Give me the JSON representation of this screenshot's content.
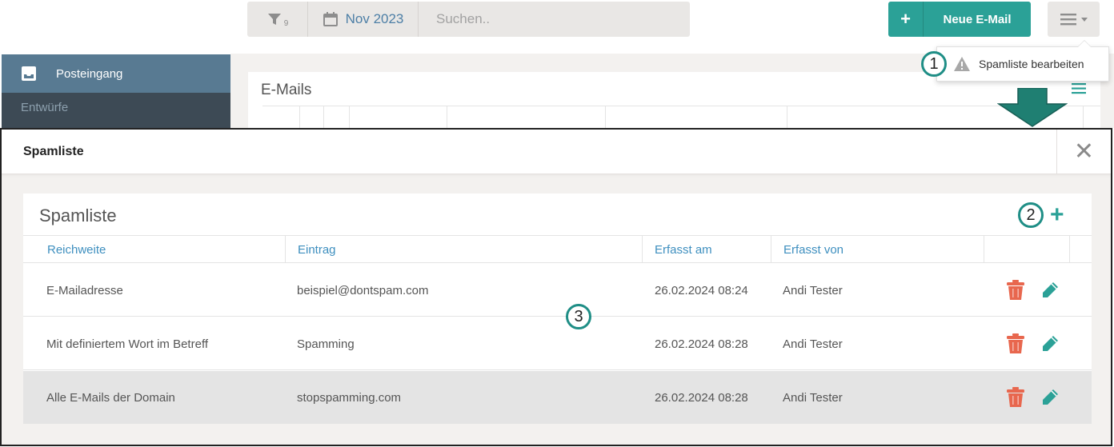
{
  "toolbar": {
    "filter_count": "9",
    "date_label": "Nov 2023",
    "search_placeholder": "Suchen.."
  },
  "new_mail": {
    "label": "Neue E-Mail"
  },
  "dropdown": {
    "spam_item_label": "Spamliste bearbeiten"
  },
  "callouts": {
    "one": "1",
    "two": "2",
    "three": "3"
  },
  "sidebar": {
    "items": [
      {
        "label": "Posteingang"
      },
      {
        "label": "Entwürfe"
      }
    ]
  },
  "emails_panel": {
    "title": "E-Mails"
  },
  "modal": {
    "title": "Spamliste",
    "panel_title": "Spamliste",
    "columns": [
      "Reichweite",
      "Eintrag",
      "Erfasst am",
      "Erfasst von"
    ],
    "rows": [
      {
        "scope": "E-Mailadresse",
        "entry": "beispiel@dontspam.com",
        "date": "26.02.2024 08:24",
        "by": "Andi Tester"
      },
      {
        "scope": "Mit definiertem Wort im Betreff",
        "entry": "Spamming",
        "date": "26.02.2024 08:28",
        "by": "Andi Tester"
      },
      {
        "scope": "Alle E-Mails der Domain",
        "entry": "stopspamming.com",
        "date": "26.02.2024 08:28",
        "by": "Andi Tester"
      }
    ]
  },
  "colors": {
    "accent_teal": "#2ba197",
    "link_blue": "#3e8fbf",
    "delete_red": "#e8674e",
    "sidebar_active": "#587a92"
  },
  "icons": [
    "filter-icon",
    "calendar-icon",
    "plus-icon",
    "hamburger-icon",
    "warning-icon",
    "inbox-icon",
    "close-icon",
    "add-icon",
    "trash-icon",
    "pencil-icon",
    "down-arrow-icon"
  ]
}
